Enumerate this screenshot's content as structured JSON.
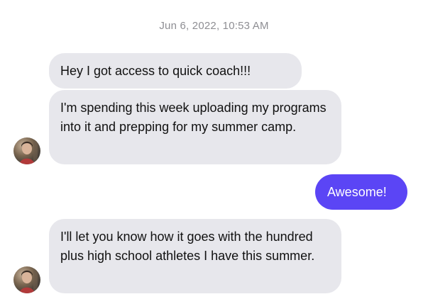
{
  "conversation": {
    "timestamp": "Jun 6, 2022, 10:53 AM",
    "messages": [
      {
        "direction": "incoming",
        "text": "Hey I got access to quick coach!!!"
      },
      {
        "direction": "incoming",
        "text": "I'm spending this week uploading my programs into it and prepping for my summer camp."
      },
      {
        "direction": "outgoing",
        "text": "Awesome!"
      },
      {
        "direction": "incoming",
        "text": "I'll let you know how it goes with the hundred plus high school athletes I have this summer."
      }
    ]
  },
  "colors": {
    "incoming_bubble": "#e7e7ec",
    "outgoing_bubble": "#5b45f5",
    "timestamp_text": "#8e8e93"
  },
  "icons": {
    "avatar": "user-avatar-photo"
  }
}
